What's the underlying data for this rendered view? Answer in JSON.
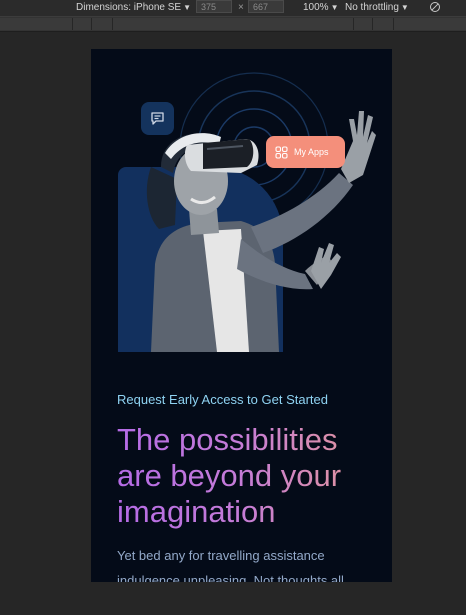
{
  "toolbar": {
    "dimensions_label": "Dimensions: iPhone SE",
    "width_value": "375",
    "times_symbol": "×",
    "height_value": "667",
    "zoom_label": "100%",
    "throttling_label": "No throttling",
    "rotate_icon": "rotate-icon"
  },
  "hero": {
    "chat_icon": "chat-icon",
    "apps_icon": "grid-icon",
    "apps_label": "My Apps"
  },
  "content": {
    "eyebrow": "Request Early Access to Get Started",
    "headline_lines": [
      "The possibilities",
      "are beyond your",
      "imagination"
    ],
    "body_lines": [
      "Yet bed any for travelling assistance",
      "indulgence unpleasing. Not thoughts all"
    ]
  },
  "colors": {
    "page_bg": "#040b18",
    "accent_coral": "#f48f7b",
    "eyebrow_cyan": "#8fd3f2",
    "headline_gradient": [
      "#b56be6",
      "#e79a91"
    ]
  }
}
